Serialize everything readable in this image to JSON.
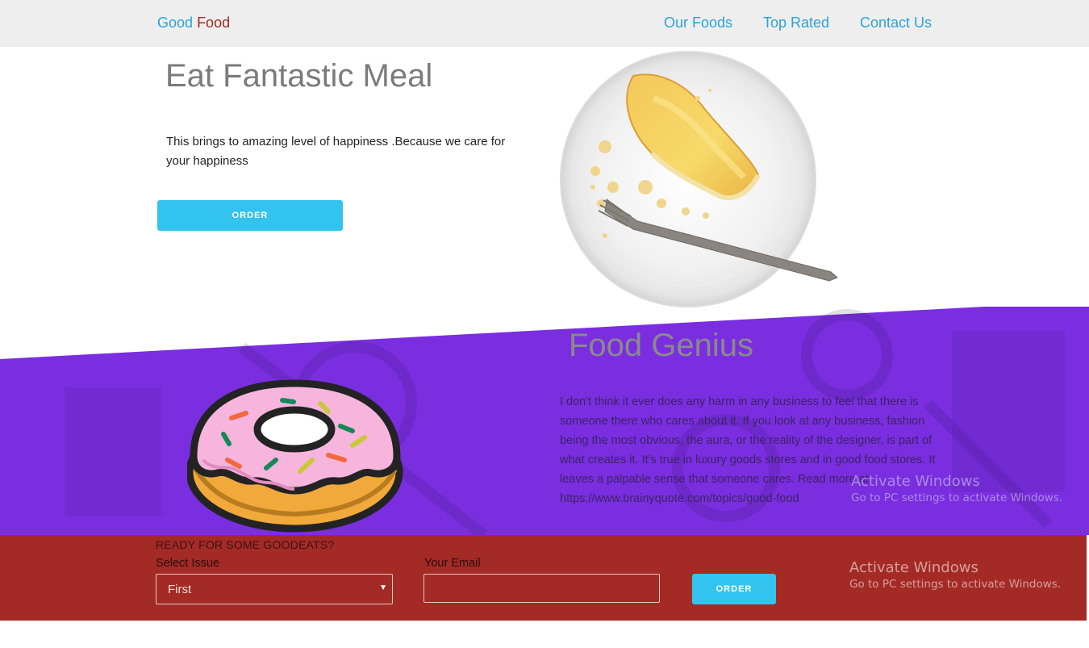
{
  "nav": {
    "brand_part1": "Good",
    "brand_part2": "Food",
    "links": [
      "Our Foods",
      "Top Rated",
      "Contact Us"
    ]
  },
  "hero": {
    "title": "Eat Fantastic Meal",
    "text": "This brings to amazing level of happiness .Because we care for your happiness",
    "button_label": "ORDER",
    "image": "cheesecake-plate-image"
  },
  "feature": {
    "title": "Food Genius",
    "text": "I don't think it ever does any harm in any business to feel that there is someone there who cares about it. If you look at any business, fashion being the most obvious, the aura, or the reality of the designer, is part of what creates it. It's true in luxury goods stores and in good food stores. It leaves a palpable sense that someone cares. Read more at: https://www.brainyquote.com/topics/good-food",
    "image": "donut-icon"
  },
  "form": {
    "heading": "READY FOR SOME GOODEATS?",
    "select_label": "Select Issue",
    "select_value": "First",
    "email_label": "Your Email",
    "email_value": "",
    "button_label": "ORDER"
  },
  "watermark": {
    "title": "Activate Windows",
    "subtitle": "Go to PC settings to activate Windows."
  },
  "colors": {
    "accent": "#33c3ef",
    "link": "#2aa4d4",
    "purple": "#7a2ee0",
    "form_bg": "#a42a26"
  }
}
